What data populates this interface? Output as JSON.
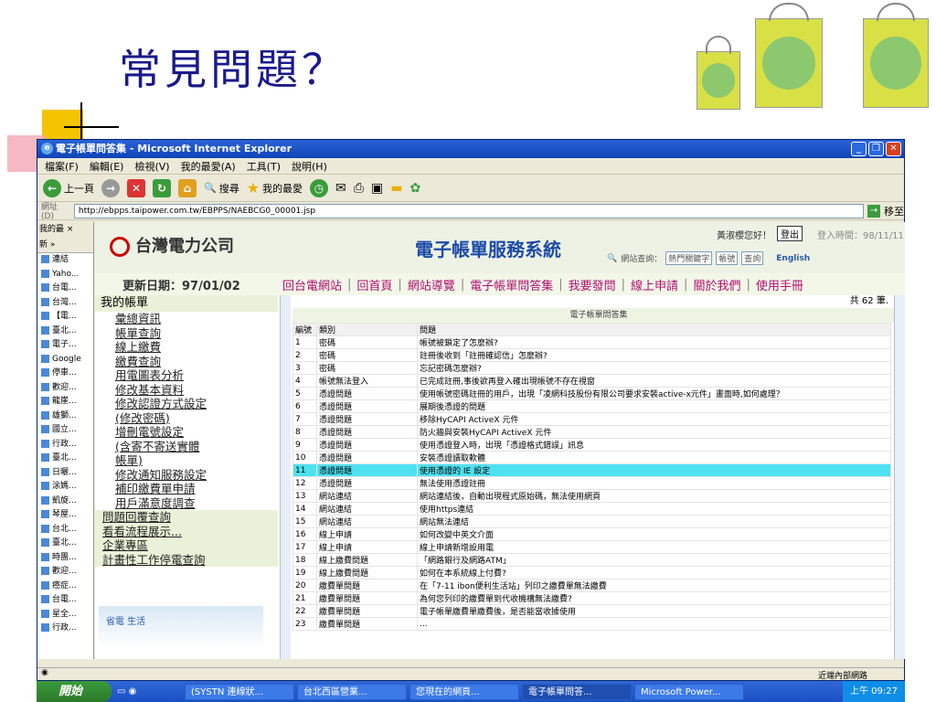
{
  "slide": {
    "title": "常見問題？"
  },
  "window": {
    "title": "電子帳單問答集 - Microsoft Internet Explorer",
    "menu": [
      "檔案(F)",
      "編輯(E)",
      "檢視(V)",
      "我的最愛(A)",
      "工具(T)",
      "說明(H)"
    ],
    "toolbar": {
      "back": "上一頁",
      "search": "搜尋",
      "favorites": "我的最愛"
    },
    "address_label": "網址(D)",
    "address": "http://ebpps.taipower.com.tw/EBPPS/NAEBCG0_00001.jsp",
    "go_label": "移至"
  },
  "favorites": {
    "header": "我的最 ×",
    "new_label": "新 »",
    "items": [
      "連結",
      "Yaho...",
      "台電...",
      "台灣...",
      "【電...",
      "臺北...",
      "電子...",
      "Google",
      "停車...",
      "歡迎...",
      "龍崖...",
      "雄獅...",
      "國立...",
      "行政...",
      "臺北...",
      "日曬...",
      "涂媽...",
      "凱旋...",
      "琴屋...",
      "台北...",
      "臺北...",
      "時團...",
      "歡迎...",
      "癌症...",
      "台電...",
      "星全...",
      "行政..."
    ]
  },
  "banner": {
    "logo": "台灣電力公司",
    "system_title": "電子帳單服務系統",
    "greeting": "黃淑櫻您好！",
    "login_button": "登出",
    "login_time": "登入時間：98/11/11",
    "search_label": "網站查詢：",
    "search_value": "熱門關鍵字",
    "search_type": "帳號",
    "search_button": "查詢",
    "english": "English"
  },
  "updated": "更新日期：97/01/02",
  "topnav": [
    "回台電網站",
    "回首頁",
    "網站導覽",
    "電子帳單問答集",
    "我要發問",
    "線上申請",
    "關於我們",
    "使用手冊"
  ],
  "leftnav": {
    "header": "我的帳單",
    "items": [
      "彙總資訊",
      "帳單查詢",
      "線上繳費",
      "繳費查詢",
      "用電圖表分析",
      "修改基本資料",
      "修改認證方式設定",
      "(修改密碼)",
      "增刪電號設定",
      "(含寄不寄送實體",
      "帳單)",
      "修改通知服務設定",
      "補印繳費單申請",
      "用戶滿意度調查"
    ],
    "sections": [
      "問題回覆查詢",
      "看看流程展示...",
      "企業專區",
      "計畫性工作停電查詢"
    ],
    "footer_image": "省電 生活"
  },
  "faq": {
    "count": "共 62 筆.",
    "table_title": "電子帳單問答集",
    "headers": [
      "編號",
      "類別",
      "問題"
    ],
    "rows": [
      [
        "1",
        "密碼",
        "帳號被鎖定了怎麼辦?"
      ],
      [
        "2",
        "密碼",
        "註冊後收到「註冊確認信」怎麼辦?"
      ],
      [
        "3",
        "密碼",
        "忘記密碼怎麼辦?"
      ],
      [
        "4",
        "帳號無法登入",
        "已完成註冊,事後欲再登入確出現帳號不存在視窗"
      ],
      [
        "5",
        "憑證問題",
        "使用帳號密碼註冊的用戶，出現「凌網科技股份有限公司要求安裝active-x元件」畫面時,如何處理？"
      ],
      [
        "6",
        "憑證問題",
        "展期後憑證的問題"
      ],
      [
        "7",
        "憑證問題",
        "移除HyCAPI ActiveX 元件"
      ],
      [
        "8",
        "憑證問題",
        "防火牆與安裝HyCAPI ActiveX 元件"
      ],
      [
        "9",
        "憑證問題",
        "使用憑證登入時，出現「憑證格式錯誤」訊息"
      ],
      [
        "10",
        "憑證問題",
        "安裝憑證讀取軟體"
      ],
      [
        "11",
        "憑證問題",
        "使用憑證的 IE 設定"
      ],
      [
        "12",
        "憑證問題",
        "無法使用憑證註冊"
      ],
      [
        "13",
        "網站連結",
        "網站連結後，自動出現程式原始碼，無法使用網頁"
      ],
      [
        "14",
        "網站連結",
        "使用https連結"
      ],
      [
        "15",
        "網站連結",
        "網站無法連結"
      ],
      [
        "16",
        "線上申請",
        "如何改變中英文介面"
      ],
      [
        "17",
        "線上申請",
        "線上申請新增設用電"
      ],
      [
        "18",
        "線上繳費問題",
        "「網路銀行及網路ATM」"
      ],
      [
        "19",
        "線上繳費問題",
        "如何在本系統線上付費?"
      ],
      [
        "20",
        "繳費單問題",
        "在「7-11 ibon便利生活站」列印之繳費單無法繳費"
      ],
      [
        "21",
        "繳費單問題",
        "為何您列印的繳費單到代收機構無法繳費?"
      ],
      [
        "22",
        "繳費單問題",
        "電子帳單繳費單繳費後，是否能當收據使用"
      ],
      [
        "23",
        "繳費單問題",
        "..."
      ]
    ],
    "highlight_row": 11
  },
  "statusbar": {
    "zone": "近端內部網路"
  },
  "taskbar": {
    "start": "開始",
    "tasks": [
      "(SYSTN 連線狀...",
      "台北西區營業...",
      "您現在的網頁...",
      "電子帳單問答...",
      "Microsoft Power..."
    ],
    "clock": "上午 09:27"
  },
  "colors": {
    "title": "#1a1a8c",
    "highlight": "#4ee1f0",
    "nav_text": "#b01070",
    "system_title": "#1c4aa8"
  }
}
